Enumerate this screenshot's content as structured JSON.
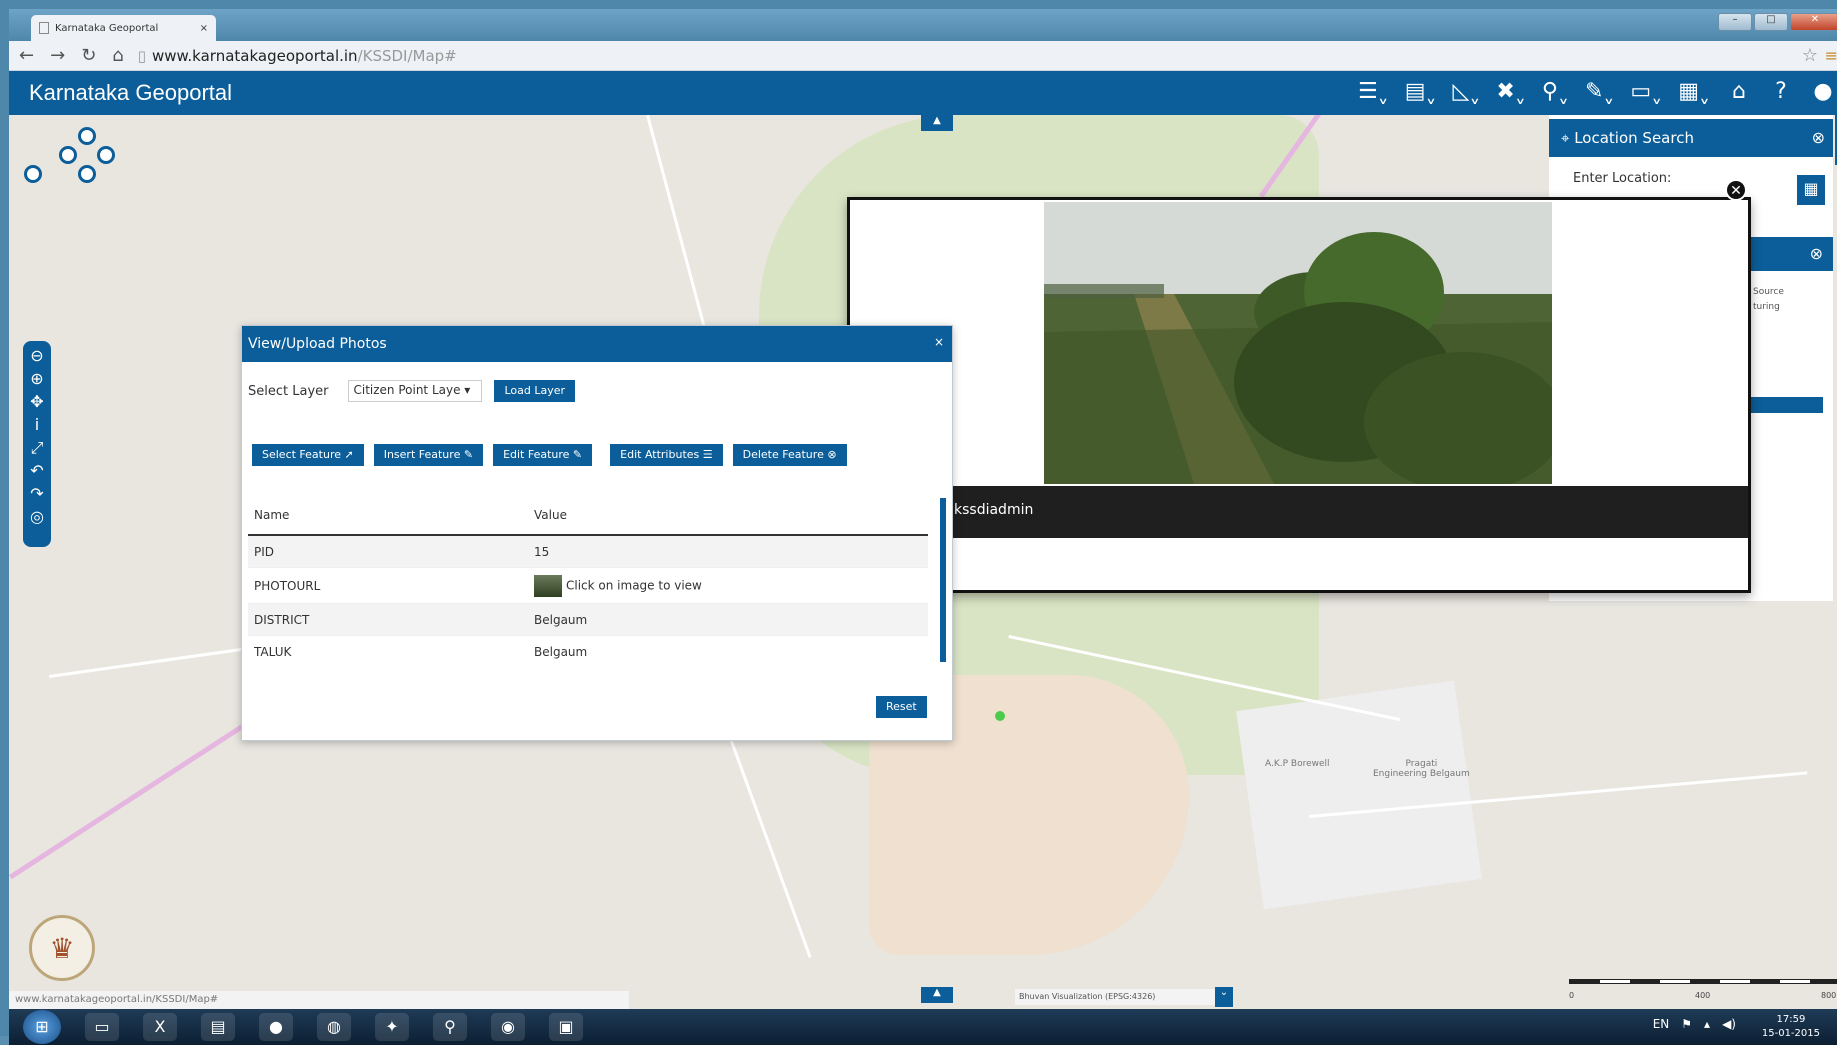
{
  "browser": {
    "tab_title": "Karnataka Geoportal",
    "tab_close": "×",
    "url_host": "www.karnatakageoportal.in",
    "url_path": "/KSSDI/Map#"
  },
  "app": {
    "title": "Karnataka Geoportal"
  },
  "toolbar": {
    "icons": [
      "layers-icon",
      "clipboard-icon",
      "measure-icon",
      "tools-icon",
      "search-icon",
      "edit-icon",
      "display-icon",
      "apps-icon",
      "home-icon",
      "help-icon",
      "user-icon"
    ]
  },
  "location_search": {
    "title": "Location Search",
    "label": "Enter Location:",
    "source_text": "Source\nturing"
  },
  "viewer": {
    "caption": "kssdiadmin"
  },
  "dialog": {
    "title": "View/Upload Photos",
    "close": "×",
    "select_layer_label": "Select Layer",
    "layer_value": "Citizen Point Laye",
    "load_layer": "Load Layer",
    "buttons": {
      "select_feature": "Select Feature",
      "insert_feature": "Insert Feature",
      "edit_feature": "Edit Feature",
      "edit_attributes": "Edit Attributes",
      "delete_feature": "Delete Feature"
    },
    "grid": {
      "header_name": "Name",
      "header_value": "Value",
      "rows": [
        {
          "name": "PID",
          "value": "15"
        },
        {
          "name": "PHOTOURL",
          "value": "Click on image to view"
        },
        {
          "name": "DISTRICT",
          "value": "Belgaum"
        },
        {
          "name": "TALUK",
          "value": "Belgaum"
        }
      ]
    },
    "reset": "Reset"
  },
  "map": {
    "labels": [
      "A.K.P Borewell",
      "Pragati\nEngineering Belgaum"
    ],
    "basemap": "Bhuvan Visualization (EPSG:4326)",
    "scale_labels": [
      "0",
      "400",
      "800"
    ]
  },
  "status_url": "www.karnatakageoportal.in/KSSDI/Map#",
  "taskbar": {
    "lang": "EN",
    "time": "17:59",
    "date": "15-01-2015"
  }
}
